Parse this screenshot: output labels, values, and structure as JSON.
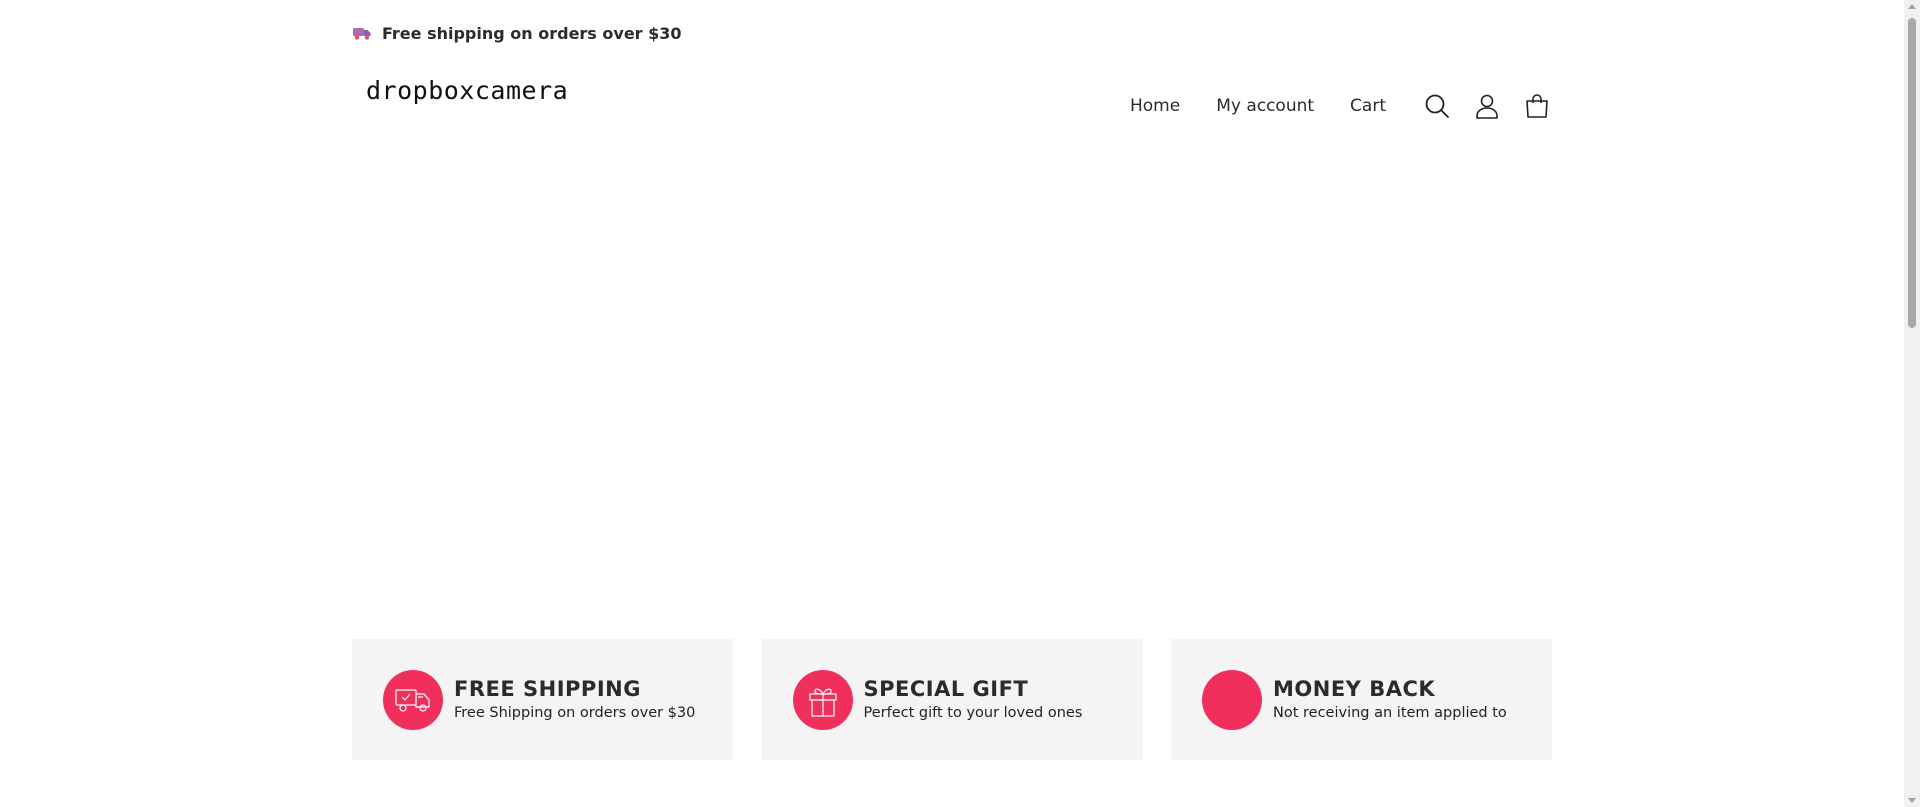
{
  "announcement": {
    "icon": "truck-icon",
    "text": "Free shipping on orders over $30"
  },
  "header": {
    "logo": "dropboxcamera",
    "nav": [
      {
        "label": "Home"
      },
      {
        "label": "My account"
      },
      {
        "label": "Cart"
      }
    ],
    "icons": [
      "search-icon",
      "user-icon",
      "shopping-bag-icon"
    ]
  },
  "features": [
    {
      "icon": "delivery-truck-icon",
      "title": "FREE SHIPPING",
      "desc": "Free Shipping on orders over $30"
    },
    {
      "icon": "gift-icon",
      "title": "SPECIAL GIFT",
      "desc": "Perfect gift to your loved ones"
    },
    {
      "icon": "money-back-icon",
      "title": "MONEY BACK",
      "desc": "Not receiving an item applied to"
    }
  ],
  "colors": {
    "accent": "#f02f5c",
    "feature_bg": "#f4f4f4",
    "text": "#2b2b2b"
  }
}
